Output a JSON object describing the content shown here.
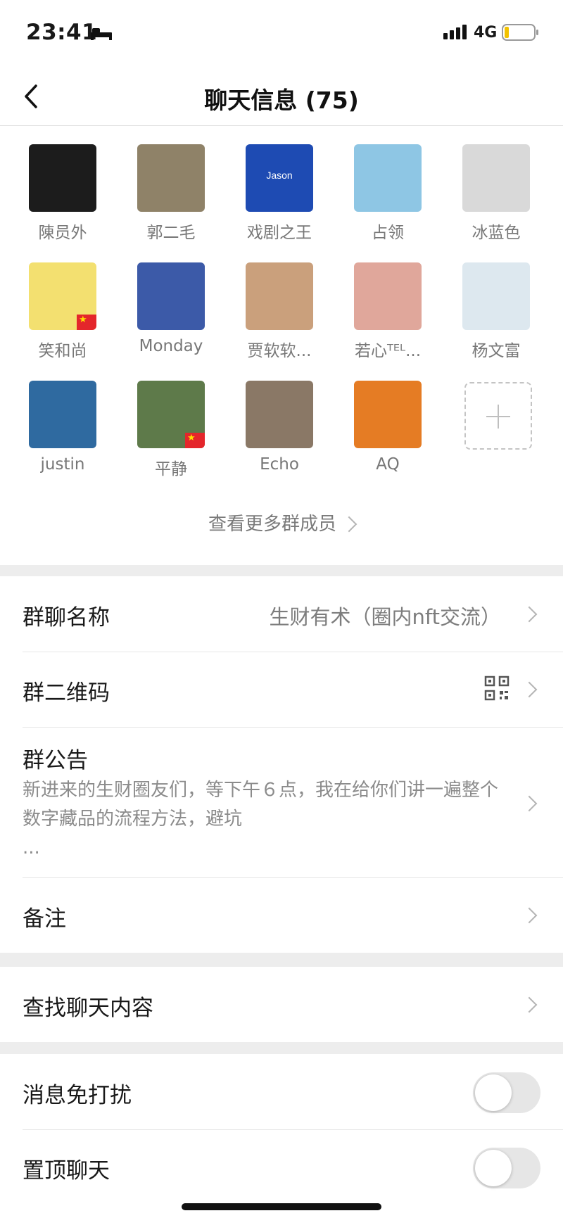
{
  "status_bar": {
    "time": "23:41",
    "network": "4G"
  },
  "nav": {
    "title": "聊天信息 (75)"
  },
  "members": [
    {
      "name": "陳员外",
      "icon": "person-photo-avatar",
      "bg": "#1c1c1c"
    },
    {
      "name": "郭二毛",
      "icon": "alien-sign-avatar",
      "bg": "#8f8268"
    },
    {
      "name": "戏剧之王",
      "icon": "eu-flag-avatar",
      "bg": "#1e4bb3",
      "text": "Jason"
    },
    {
      "name": "占领",
      "icon": "sky-clouds-avatar",
      "bg": "#8ec6e4"
    },
    {
      "name": "冰蓝色",
      "icon": "cartoon-character-avatar",
      "bg": "#d9d9d9"
    },
    {
      "name": "笑和尚",
      "icon": "buddha-cartoon-avatar",
      "bg": "#f3e070",
      "flag": true
    },
    {
      "name": "Monday",
      "icon": "robot-toy-avatar",
      "bg": "#3c5aa8"
    },
    {
      "name": "贾软软...",
      "icon": "child-photo-avatar",
      "bg": "#caa07c"
    },
    {
      "name": "若心ᵀᴱᴸ...",
      "icon": "girl-selfie-avatar",
      "bg": "#e0a79b"
    },
    {
      "name": "杨文富",
      "icon": "man-portrait-avatar",
      "bg": "#dde8ef"
    },
    {
      "name": "justin",
      "icon": "stadium-avatar",
      "bg": "#2f6aa0"
    },
    {
      "name": "平静",
      "icon": "flower-tree-avatar",
      "bg": "#5e7a4a",
      "flag": true
    },
    {
      "name": "Echo",
      "icon": "young-man-avatar",
      "bg": "#8a7866"
    },
    {
      "name": "AQ",
      "icon": "wolf-suit-avatar",
      "bg": "#e57c24"
    }
  ],
  "more_members": "查看更多群成员",
  "group_name": {
    "label": "群聊名称",
    "value": "生财有术（圈内nft交流）"
  },
  "qr_code": {
    "label": "群二维码"
  },
  "notice": {
    "label": "群公告",
    "text": "新进来的生财圈友们，等下午６点，我在给你们讲一遍整个数字藏品的流程方法，避坑",
    "ellipsis": "..."
  },
  "remark": {
    "label": "备注"
  },
  "search": {
    "label": "查找聊天内容"
  },
  "mute": {
    "label": "消息免打扰",
    "on": false
  },
  "pin": {
    "label": "置顶聊天",
    "on": false
  }
}
